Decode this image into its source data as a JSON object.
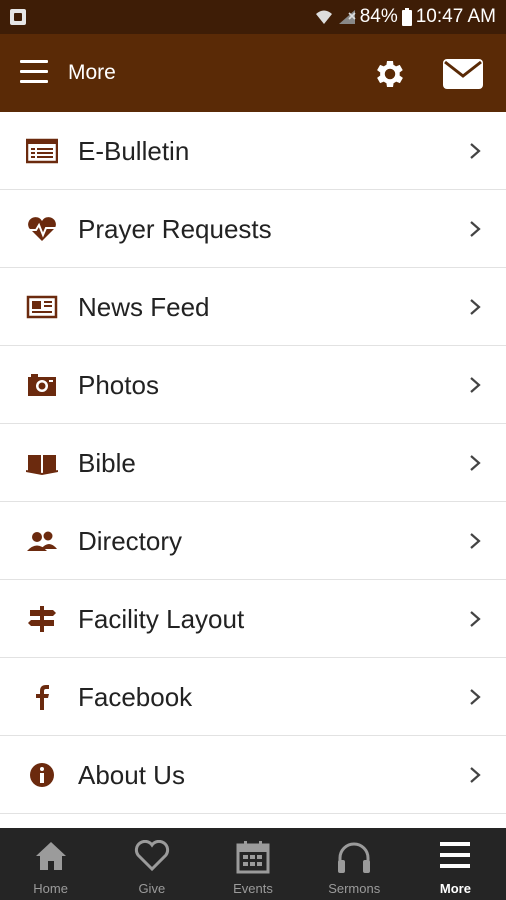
{
  "status": {
    "battery": "84%",
    "time": "10:47 AM"
  },
  "header": {
    "title": "More"
  },
  "menu": [
    {
      "label": "E-Bulletin",
      "icon": "bulletin-icon"
    },
    {
      "label": "Prayer Requests",
      "icon": "heart-pulse-icon"
    },
    {
      "label": "News Feed",
      "icon": "newspaper-icon"
    },
    {
      "label": "Photos",
      "icon": "camera-icon"
    },
    {
      "label": "Bible",
      "icon": "book-icon"
    },
    {
      "label": "Directory",
      "icon": "people-icon"
    },
    {
      "label": "Facility Layout",
      "icon": "signpost-icon"
    },
    {
      "label": "Facebook",
      "icon": "facebook-icon"
    },
    {
      "label": "About Us",
      "icon": "info-icon"
    }
  ],
  "tabs": [
    {
      "label": "Home",
      "icon": "home-icon"
    },
    {
      "label": "Give",
      "icon": "heart-outline-icon"
    },
    {
      "label": "Events",
      "icon": "calendar-icon"
    },
    {
      "label": "Sermons",
      "icon": "headphones-icon"
    },
    {
      "label": "More",
      "icon": "more-menu-icon",
      "active": true
    }
  ],
  "colors": {
    "statusbar": "#3e1d06",
    "header": "#5a2a06",
    "icon": "#6b2a0e",
    "tabbar": "#252525"
  }
}
